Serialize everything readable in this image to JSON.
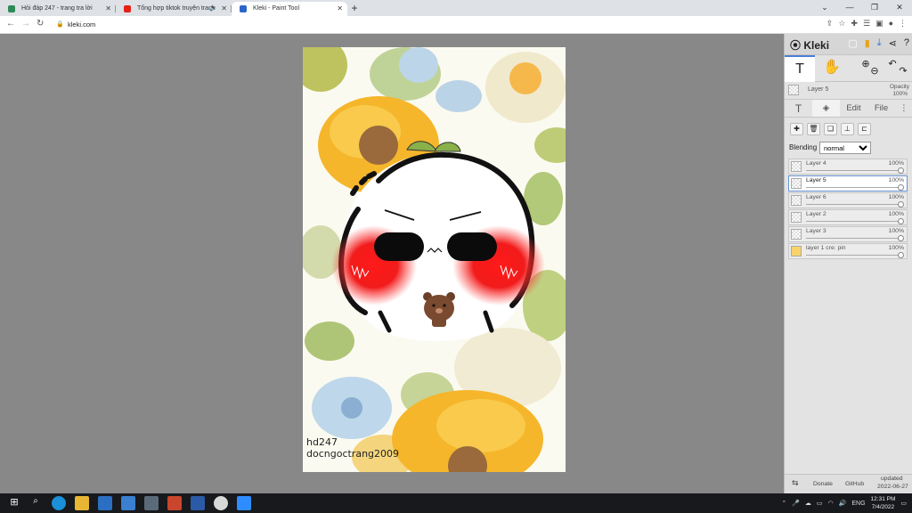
{
  "tabs": [
    {
      "title": "Hỏi đáp 247 - trang tra lời",
      "color": "#2e8b57"
    },
    {
      "title": "Tổng hợp tiktok truyện tranh",
      "color": "#e62117"
    },
    {
      "title": "Kleki - Paint Tool",
      "color": "#2c64c8"
    }
  ],
  "address": {
    "url": "kleki.com"
  },
  "app": {
    "logo": "Kleki"
  },
  "current_layer": {
    "name": "Layer 5",
    "opacity_label": "Opacity",
    "opacity_value": "100%"
  },
  "panel_tabs": {
    "edit": "Edit",
    "file": "File"
  },
  "blending": {
    "label": "Blending",
    "value": "normal",
    "options": [
      "normal"
    ]
  },
  "layers": [
    {
      "name": "Layer 4",
      "opacity": "100%",
      "selected": false
    },
    {
      "name": "Layer 5",
      "opacity": "100%",
      "selected": true
    },
    {
      "name": "Layer 6",
      "opacity": "100%",
      "selected": false
    },
    {
      "name": "Layer 2",
      "opacity": "100%",
      "selected": false
    },
    {
      "name": "Layer 3",
      "opacity": "100%",
      "selected": false
    },
    {
      "name": "layer 1 cre: pin",
      "opacity": "100%",
      "selected": false
    }
  ],
  "footer": {
    "donate": "Donate",
    "github": "GitHub",
    "updated_label": "updated",
    "updated_date": "2022-06-27"
  },
  "artwork": {
    "sig1": "hd247",
    "sig2": "docngoctrang2009"
  },
  "taskbar": {
    "lang": "ENG",
    "time": "12:31 PM",
    "date": "7/4/2022"
  }
}
